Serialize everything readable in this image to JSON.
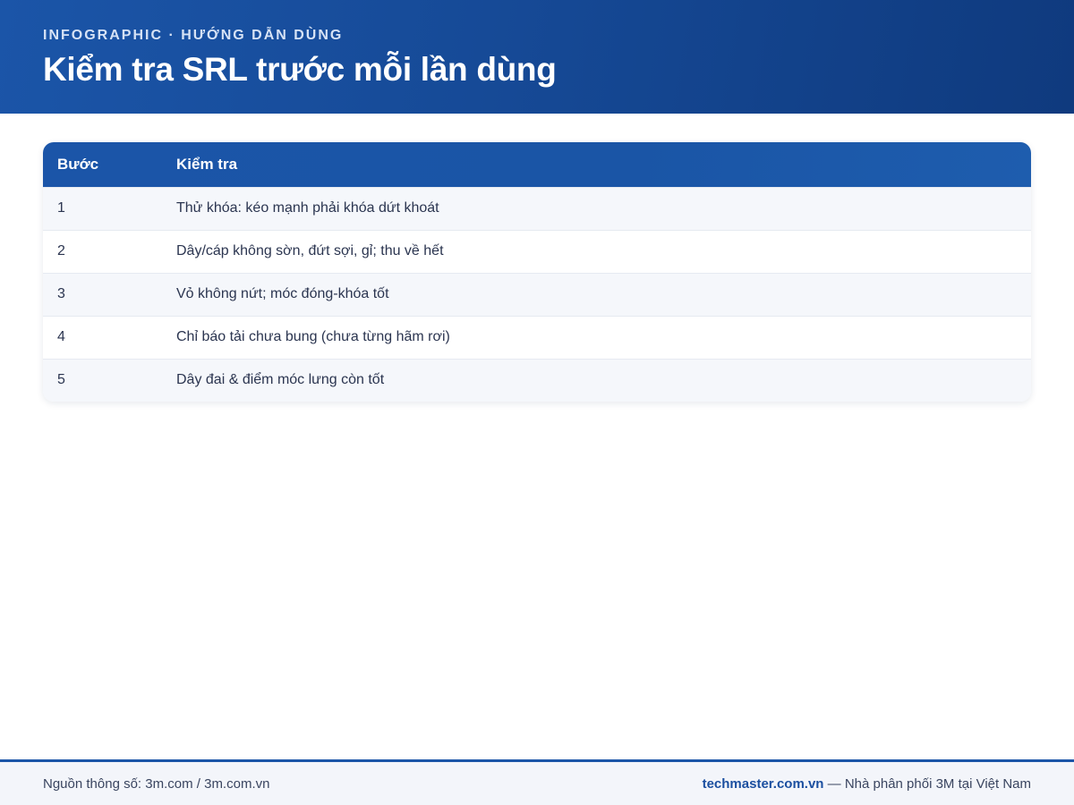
{
  "header": {
    "kicker": "INFOGRAPHIC · HƯỚNG DẪN DÙNG",
    "title": "Kiểm tra SRL trước mỗi lần dùng"
  },
  "table": {
    "columns": [
      "Bước",
      "Kiểm tra"
    ],
    "rows": [
      {
        "step": "1",
        "check": "Thử khóa: kéo mạnh phải khóa dứt khoát"
      },
      {
        "step": "2",
        "check": "Dây/cáp không sờn, đứt sợi, gỉ; thu về hết"
      },
      {
        "step": "3",
        "check": "Vỏ không nứt; móc đóng-khóa tốt"
      },
      {
        "step": "4",
        "check": "Chỉ báo tải chưa bung (chưa từng hãm rơi)"
      },
      {
        "step": "5",
        "check": "Dây đai & điểm móc lưng còn tốt"
      }
    ]
  },
  "footer": {
    "source": "Nguồn thông số: 3m.com / 3m.com.vn",
    "brand": "techmaster.com.vn",
    "tagline": " — Nhà phân phối 3M tại Việt Nam"
  },
  "colors": {
    "primary": "#1b55a8",
    "header_dark": "#0f3a7e",
    "row_alt": "#f5f7fb"
  }
}
